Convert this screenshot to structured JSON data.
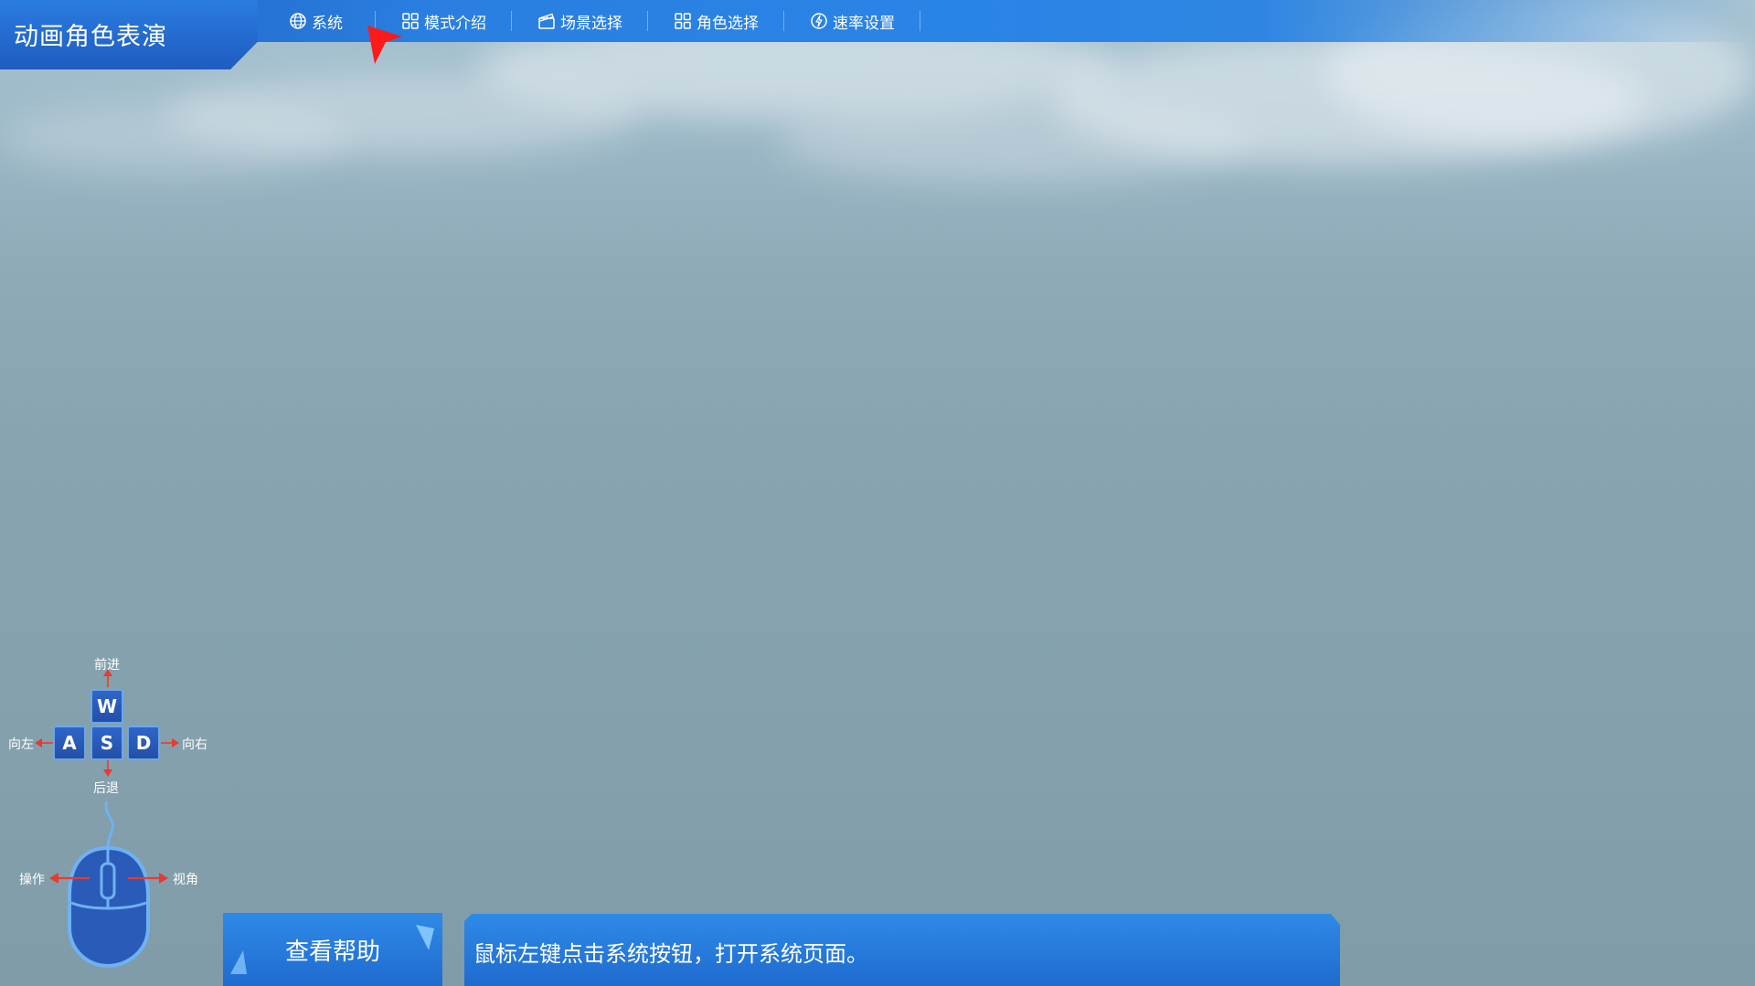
{
  "app": {
    "title": "动画角色表演"
  },
  "menu": {
    "items": [
      {
        "label": "系统",
        "icon": "globe-icon"
      },
      {
        "label": "模式介绍",
        "icon": "grid-icon"
      },
      {
        "label": "场景选择",
        "icon": "clapperboard-icon"
      },
      {
        "label": "角色选择",
        "icon": "grid-icon"
      },
      {
        "label": "速率设置",
        "icon": "bolt-circle-icon"
      }
    ]
  },
  "keyboard_help": {
    "keys": {
      "w": "W",
      "a": "A",
      "s": "S",
      "d": "D"
    },
    "labels": {
      "forward": "前进",
      "back": "后退",
      "left": "向左",
      "right": "向右"
    }
  },
  "mouse_help": {
    "labels": {
      "left": "操作",
      "right": "视角"
    }
  },
  "bottom": {
    "help_button": "查看帮助",
    "hint": "鼠标左键点击系统按钮，打开系统页面。"
  },
  "colors": {
    "accent": "#2a84e6",
    "accent_dark": "#1f5cc0",
    "key_fill": "#2a5bb8",
    "arrow_red": "#e83a2e",
    "cursor_red": "#ff1a1a"
  }
}
